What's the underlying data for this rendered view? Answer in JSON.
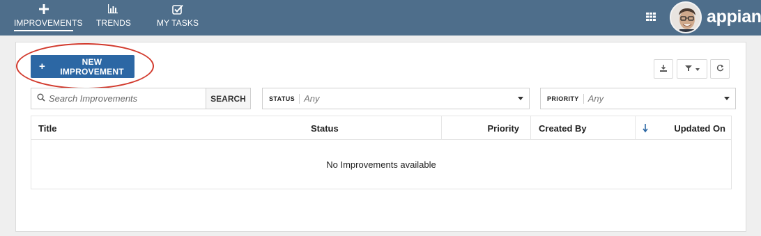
{
  "nav": {
    "tabs": [
      {
        "label": "IMPROVEMENTS",
        "icon": "plus-icon",
        "active": true
      },
      {
        "label": "TRENDS",
        "icon": "bar-chart-icon",
        "active": false
      },
      {
        "label": "MY TASKS",
        "icon": "checkbox-icon",
        "active": false
      }
    ],
    "logo": "appian",
    "apps_icon": "grid-icon"
  },
  "toolbar": {
    "new_button_label": "NEW IMPROVEMENT",
    "new_button_icon": "+",
    "download_icon": "download-icon",
    "filter_icon": "filter-icon",
    "refresh_icon": "refresh-icon"
  },
  "search": {
    "placeholder": "Search Improvements",
    "button_label": "SEARCH"
  },
  "filters": {
    "status": {
      "label": "STATUS",
      "value": "Any"
    },
    "priority": {
      "label": "PRIORITY",
      "value": "Any"
    }
  },
  "table": {
    "columns": [
      "Title",
      "Status",
      "Priority",
      "Created By",
      "Updated On"
    ],
    "sort_column": "Updated On",
    "sort_direction": "descending",
    "empty_message": "No Improvements available"
  },
  "colors": {
    "nav_bg": "#4e6e8b",
    "primary_button": "#2c67a4",
    "highlight": "#d23a2d"
  }
}
